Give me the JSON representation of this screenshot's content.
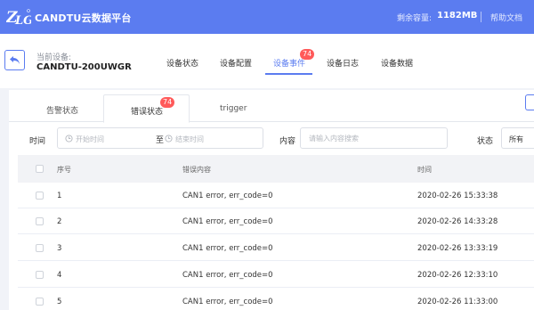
{
  "app": {
    "title": "CANDTU云数据平台",
    "space_label": "剩余容量:",
    "space_value": "1182MB",
    "help_label": "帮助文档",
    "logo_icon": "zlg-logo",
    "colors": {
      "primary": "#5b7cf0",
      "badge": "#ff5a5a"
    }
  },
  "device": {
    "label": "当前设备:",
    "name": "CANDTU-200UWGR",
    "back_icon": "back-arrow-icon"
  },
  "nav": {
    "tabs": [
      {
        "label": "设备状态"
      },
      {
        "label": "设备配置"
      },
      {
        "label": "设备事件",
        "badge": "74",
        "active": true
      },
      {
        "label": "设备日志"
      },
      {
        "label": "设备数据"
      }
    ]
  },
  "subtabs": [
    {
      "label": "告警状态"
    },
    {
      "label": "错误状态",
      "badge": "74",
      "active": true
    },
    {
      "label": "trigger"
    }
  ],
  "filters": {
    "time_label": "时间",
    "start_placeholder": "开始时间",
    "range_separator": "至",
    "end_placeholder": "结束时间",
    "content_label": "内容",
    "content_placeholder": "请输入内容搜索",
    "status_label": "状态",
    "status_value": "所有"
  },
  "table": {
    "headers": {
      "index": "序号",
      "content": "错误内容",
      "time": "时间"
    },
    "rows": [
      {
        "index": "1",
        "content": "CAN1 error, err_code=0",
        "time": "2020-02-26 15:33:38"
      },
      {
        "index": "2",
        "content": "CAN1 error, err_code=0",
        "time": "2020-02-26 14:33:28"
      },
      {
        "index": "3",
        "content": "CAN1 error, err_code=0",
        "time": "2020-02-26 13:33:19"
      },
      {
        "index": "4",
        "content": "CAN1 error, err_code=0",
        "time": "2020-02-26 12:33:10"
      },
      {
        "index": "5",
        "content": "CAN1 error, err_code=0",
        "time": "2020-02-26 11:33:00"
      }
    ]
  }
}
